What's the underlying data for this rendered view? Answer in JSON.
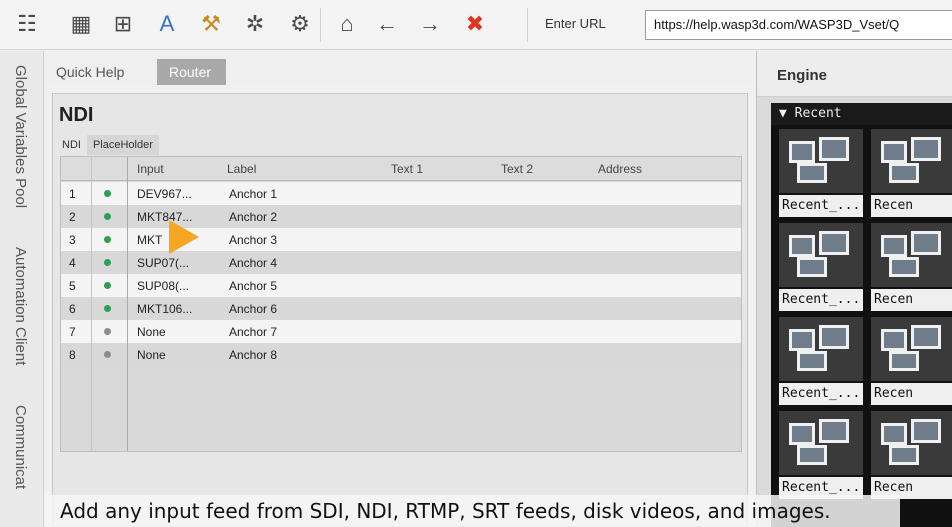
{
  "toolbar": {
    "icons": [
      {
        "name": "list-settings-icon",
        "glyph": "☷"
      },
      {
        "name": "calendar-grid-icon",
        "glyph": "▦"
      },
      {
        "name": "table-icon",
        "glyph": "⊞"
      },
      {
        "name": "text-style-icon",
        "glyph": "A"
      },
      {
        "name": "tools-icon",
        "glyph": "⚒"
      },
      {
        "name": "puzzle-settings-icon",
        "glyph": "✲"
      },
      {
        "name": "gear-icon",
        "glyph": "⚙"
      },
      {
        "name": "home-icon",
        "glyph": "⌂"
      },
      {
        "name": "back-arrow-icon",
        "glyph": "←"
      },
      {
        "name": "forward-arrow-icon",
        "glyph": "→"
      },
      {
        "name": "close-x-icon",
        "glyph": "✖"
      }
    ],
    "url_label": "Enter URL",
    "url_value": "https://help.wasp3d.com/WASP3D_Vset/Q"
  },
  "rail": {
    "tabs": [
      "Global Variables Pool",
      "Automation Client",
      "Communicat"
    ]
  },
  "center": {
    "tabs": [
      "Quick Help",
      "Router"
    ],
    "active_tab": "Router"
  },
  "panel": {
    "title": "NDI",
    "subtabs": [
      "NDI",
      "PlaceHolder"
    ],
    "columns": [
      "Input",
      "Label",
      "Text 1",
      "Text 2",
      "Address"
    ],
    "rows": [
      {
        "num": "1",
        "status": "active",
        "input": "DEV967...",
        "label": "Anchor 1"
      },
      {
        "num": "2",
        "status": "active",
        "input": "MKT847...",
        "label": "Anchor 2"
      },
      {
        "num": "3",
        "status": "active",
        "input": "MKT",
        "label": "Anchor 3"
      },
      {
        "num": "4",
        "status": "active",
        "input": "SUP07(...",
        "label": "Anchor 4"
      },
      {
        "num": "5",
        "status": "active",
        "input": "SUP08(...",
        "label": "Anchor 5"
      },
      {
        "num": "6",
        "status": "active",
        "input": "MKT106...",
        "label": "Anchor 6"
      },
      {
        "num": "7",
        "status": "inactive",
        "input": "None",
        "label": "Anchor 7"
      },
      {
        "num": "8",
        "status": "inactive",
        "input": "None",
        "label": "Anchor 8"
      }
    ],
    "status_colors": {
      "active": "#2e9e4f",
      "inactive": "#8c8c8c"
    }
  },
  "engine": {
    "title": "Engine",
    "section": "Recent",
    "thumbnails": [
      {
        "label": "Recent_..."
      },
      {
        "label": "Recen"
      },
      {
        "label": "Recent_..."
      },
      {
        "label": "Recen"
      },
      {
        "label": "Recent_..."
      },
      {
        "label": "Recen"
      },
      {
        "label": "Recent_..."
      },
      {
        "label": "Recen"
      }
    ]
  },
  "caption": "Add any input feed from SDI, NDI, RTMP, SRT feeds, disk videos, and images.",
  "colors": {
    "toolbar_red_x": "#e0341c",
    "accent_cursor": "#f5a623",
    "router_tab": "#a9a9a9"
  }
}
